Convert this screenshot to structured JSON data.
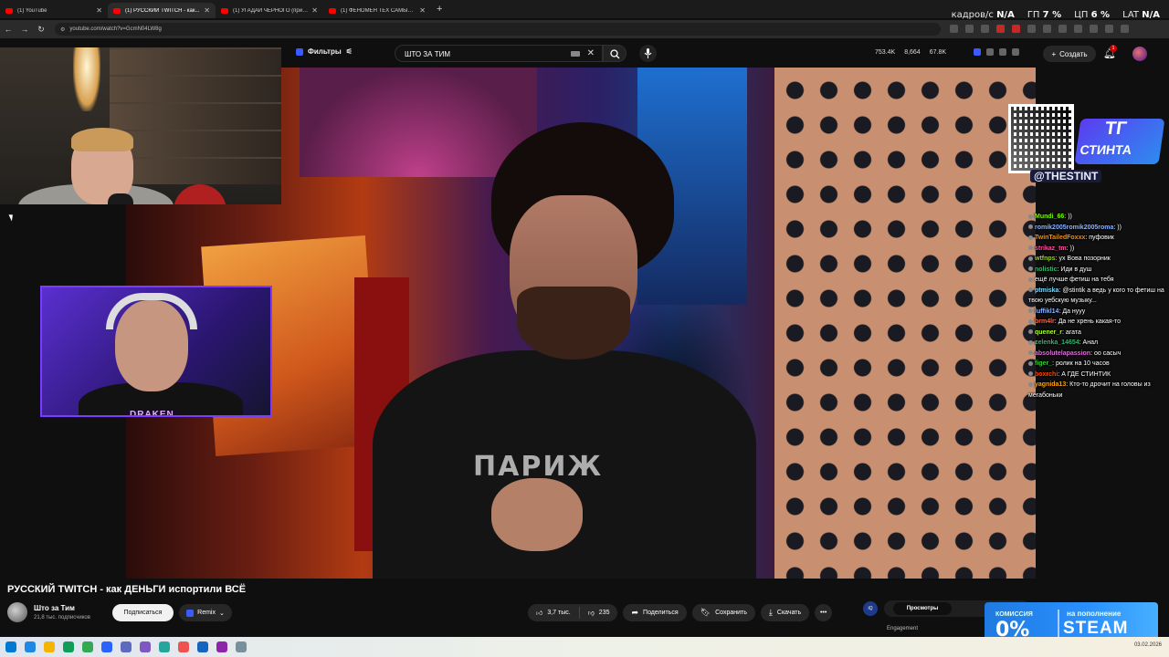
{
  "browser": {
    "tabs": [
      {
        "label": "(1) YouTube",
        "active": false
      },
      {
        "label": "(1) РУССКИЙ TWITCH - как...",
        "active": true
      },
      {
        "label": "(1) УГАДАЙ ЧЕРНОГО (при уч...",
        "active": false
      },
      {
        "label": "(1) ФЕНОМЕН ТЕХ САМЫХ ГОЛ...",
        "active": false
      }
    ],
    "url": "youtube.com/watch?v=GcmN04LW8g"
  },
  "perf_overlay": {
    "fps_label": "кадров/с",
    "fps_value": "N/A",
    "gpu_label": "ГП",
    "gpu_value": "7 %",
    "cpu_label": "ЦП",
    "cpu_value": "6 %",
    "lat_label": "LAT",
    "lat_value": "N/A"
  },
  "youtube_header": {
    "filters_label": "Фильтры",
    "search_value": "ШТО ЗА ТИМ",
    "stats": [
      "753.4K",
      "8,664",
      "67.8K"
    ],
    "create_label": "Создать",
    "notification_count": "1"
  },
  "video": {
    "shirt_text": "ПАРИЖ"
  },
  "overlays": {
    "cam2_tag": "DRAKEN",
    "tg_line1": "ТГ",
    "tg_line2": "СТИНТА",
    "tg_handle": "@THESTINT"
  },
  "chat": [
    {
      "user": "Mundi_66",
      "text": "))",
      "color": "#7CFC00"
    },
    {
      "user": "romik2005romik2005roma",
      "text": "))",
      "color": "#8ab4ff"
    },
    {
      "user": "TwinTailedFoxxx",
      "text": "пуфовик",
      "color": "#ff8c00"
    },
    {
      "user": "strikaz_tm",
      "text": "))",
      "color": "#ff4fa0"
    },
    {
      "user": "wtfnps",
      "text": "ух Вова позорник",
      "color": "#9acd32"
    },
    {
      "user": "nolistic",
      "text": "Иди в душ",
      "color": "#3cb371"
    },
    {
      "user": "",
      "text": "ещё лучше фетиш на тебя",
      "color": "#c0c0ff"
    },
    {
      "user": "ptmiska",
      "text": "@stintik а ведь у кого то фетиш на твою уебскую музыку...",
      "color": "#7fdbff"
    },
    {
      "user": "luffikl14",
      "text": "Да нууу",
      "color": "#8ab4ff"
    },
    {
      "user": "brm4lr",
      "text": "Да не хрень какая-то",
      "color": "#ff6347"
    },
    {
      "user": "quener_r",
      "text": "агата",
      "color": "#adff2f"
    },
    {
      "user": "zelenka_14654",
      "text": "Анал",
      "color": "#3cb371"
    },
    {
      "user": "absolutelapassion",
      "text": "оо сасыч",
      "color": "#da70d6"
    },
    {
      "user": "figer_",
      "text": "ролик на 10 часов",
      "color": "#32cd32"
    },
    {
      "user": "boxrchi",
      "text": "А ГДЕ СТИНТИК",
      "color": "#ff4500"
    },
    {
      "user": "yagnida13",
      "text": "Кто-то дрочит на головы из мегабоньки",
      "color": "#ffa500"
    }
  ],
  "video_info": {
    "title": "РУССКИЙ TWITCH - как ДЕНЬГИ испортили ВСЁ",
    "channel_name": "Што за Тим",
    "channel_subs": "21,8 тыс. подписчиков",
    "subscribe_label": "Подписаться",
    "remix_label": "Remix",
    "likes": "3,7 тыс.",
    "dislikes": "235",
    "share_label": "Поделиться",
    "save_label": "Сохранить",
    "download_label": "Скачать"
  },
  "engagement": {
    "icon_text": "iQ",
    "tab_label": "Просмотры",
    "label": "Engagement"
  },
  "steam_ad": {
    "line1": "КОМИССИЯ",
    "line2": "0%",
    "line3": "на пополнение",
    "line4": "STEAM"
  },
  "taskbar": {
    "icons": [
      "#1e88e5",
      "#f4b400",
      "#0f9d58",
      "#34a853",
      "#2962ff",
      "#5c6bc0",
      "#7e57c2",
      "#26a69a",
      "#ef5350",
      "#1565c0",
      "#8e24aa",
      "#78909c"
    ],
    "clock": "03.02.2026"
  }
}
